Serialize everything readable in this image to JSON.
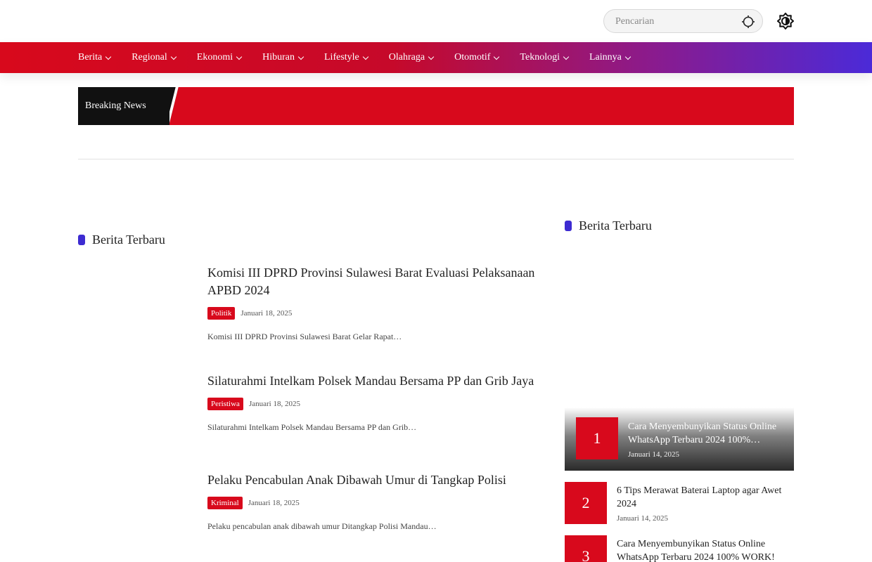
{
  "search": {
    "placeholder": "Pencarian"
  },
  "nav": {
    "items": [
      {
        "label": "Berita"
      },
      {
        "label": "Regional"
      },
      {
        "label": "Ekonomi"
      },
      {
        "label": "Hiburan"
      },
      {
        "label": "Lifestyle"
      },
      {
        "label": "Olahraga"
      },
      {
        "label": "Otomotif"
      },
      {
        "label": "Teknologi"
      },
      {
        "label": "Lainnya"
      }
    ]
  },
  "breaking": {
    "label": "Breaking News"
  },
  "main": {
    "section_title": "Berita Terbaru",
    "articles": [
      {
        "title": "Komisi III DPRD Provinsi Sulawesi Barat Evaluasi Pelaksanaan APBD 2024",
        "category": "Politik",
        "date": "Januari 18, 2025",
        "excerpt": "Komisi III DPRD Provinsi Sulawesi Barat Gelar Rapat…"
      },
      {
        "title": "Silaturahmi Intelkam Polsek Mandau Bersama PP dan Grib Jaya",
        "category": "Peristiwa",
        "date": "Januari 18, 2025",
        "excerpt": "Silaturahmi Intelkam Polsek Mandau Bersama PP dan Grib…"
      },
      {
        "title": "Pelaku Pencabulan Anak Dibawah Umur di Tangkap Polisi",
        "category": "Kriminal",
        "date": "Januari 18, 2025",
        "excerpt": "Pelaku pencabulan anak dibawah umur Ditangkap Polisi Mandau…"
      }
    ]
  },
  "sidebar": {
    "section_title": "Berita Terbaru",
    "items": [
      {
        "rank": "1",
        "title": "Cara Menyembunyikan Status Online WhatsApp Terbaru 2024 100%…",
        "date": "Januari 14, 2025"
      },
      {
        "rank": "2",
        "title": "6 Tips Merawat Baterai Laptop agar Awet 2024",
        "date": "Januari 14, 2025"
      },
      {
        "rank": "3",
        "title": "Cara Menyembunyikan Status Online WhatsApp Terbaru 2024 100% WORK!",
        "date": ""
      }
    ]
  },
  "colors": {
    "accent_red": "#d8091c",
    "accent_purple": "#3d2bd1"
  }
}
